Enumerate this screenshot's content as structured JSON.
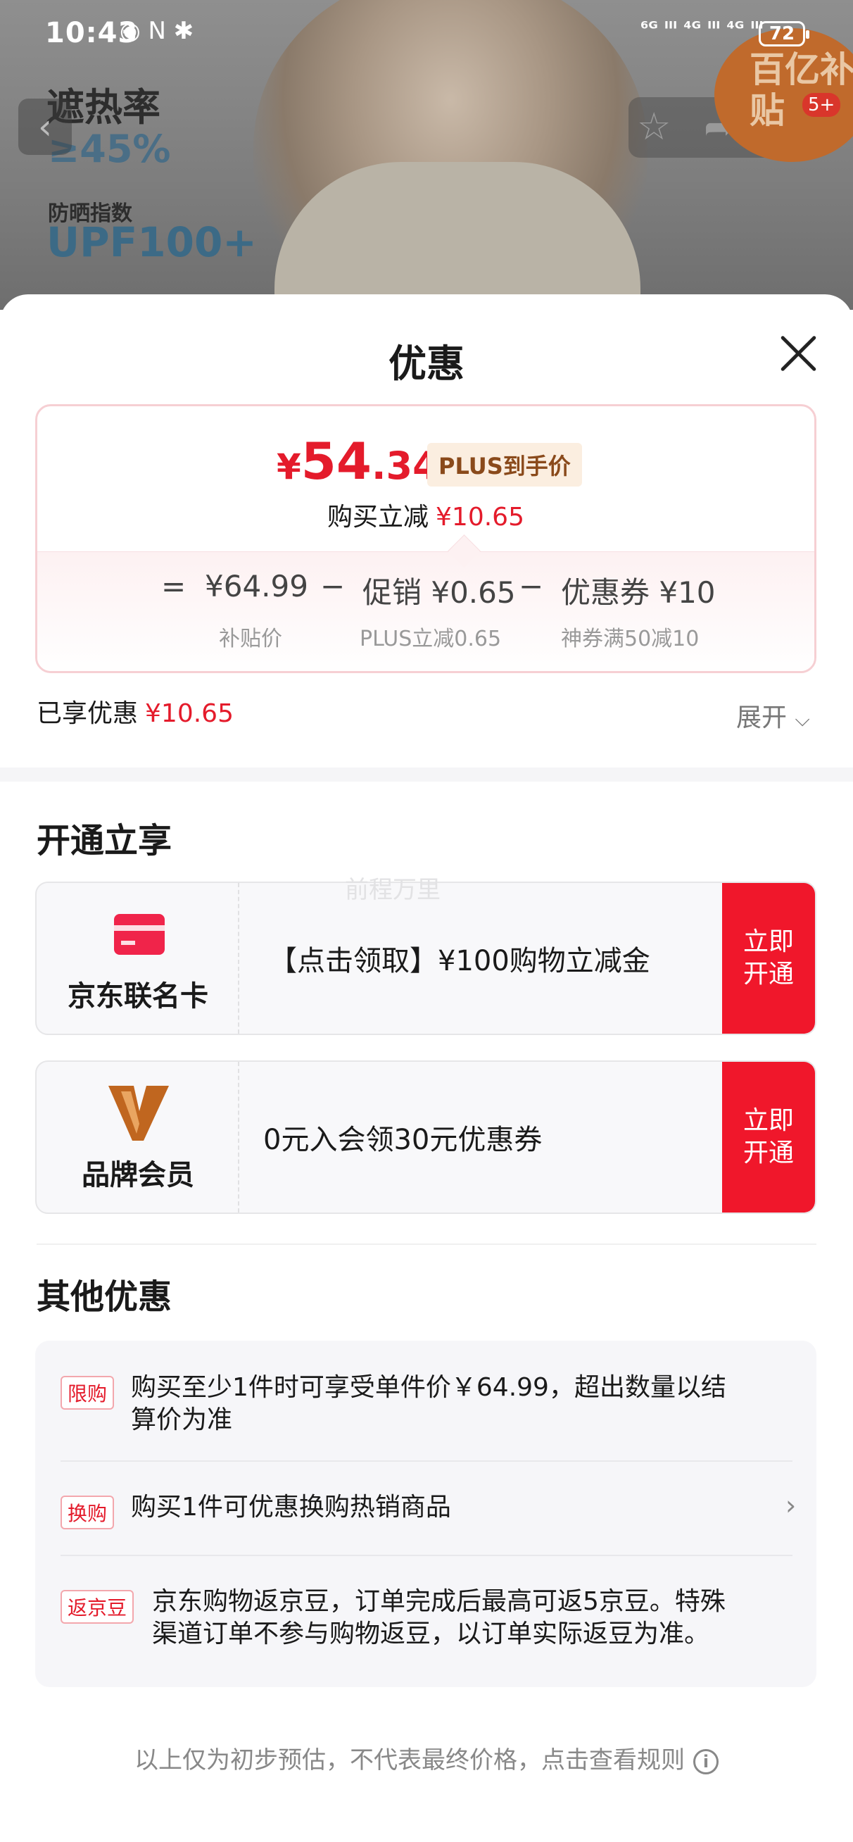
{
  "status_bar": {
    "time": "10:43",
    "left_icons": "◉ N ✱",
    "right_icons": "⁶ᴳ ᴵᴵᴵ ⁴ᴳ ᴵᴵᴵ ⁴ᴳ ᴵᴵᴵ",
    "battery": "72"
  },
  "background": {
    "line1": "遮热率",
    "line2": "≥45%",
    "line3": "防晒指数",
    "line4": "UPF100+",
    "badge_text": "百亿补贴",
    "badge_count": "5+"
  },
  "sheet": {
    "title": "优惠",
    "price": {
      "yen": "¥",
      "integer": "54",
      "decimal": ".34",
      "plus_tag": "PLUS到手价",
      "reduce_label": "购买立减",
      "reduce_value": "¥10.65"
    },
    "calc": {
      "eq": "=",
      "base_value": "¥64.99",
      "base_label": "补贴价",
      "minus1": "−",
      "promo_value": "促销 ¥0.65",
      "promo_label": "PLUS立减0.65",
      "minus2": "−",
      "coupon_value": "优惠券 ¥10",
      "coupon_label": "神券满50减10"
    },
    "enjoyed_label": "已享优惠",
    "enjoyed_value": "¥10.65",
    "expand_label": "展开",
    "open_section_title": "开通立享",
    "cards": [
      {
        "name": "京东联名卡",
        "desc": "【点击领取】¥100购物立减金",
        "btn_line1": "立即",
        "btn_line2": "开通"
      },
      {
        "name": "品牌会员",
        "desc": "0元入会领30元优惠券",
        "btn_line1": "立即",
        "btn_line2": "开通"
      }
    ],
    "watermark": "前程万里",
    "other_section_title": "其他优惠",
    "other_items": [
      {
        "tag": "限购",
        "text_line1": "购买至少1件时可享受单件价￥64.99，超出数量以结",
        "text_line2": "算价为准"
      },
      {
        "tag": "换购",
        "text_line1": "购买1件可优惠换购热销商品",
        "text_line2": ""
      },
      {
        "tag": "返京豆",
        "text_line1": "京东购物返京豆，订单完成后最高可返5京豆。特殊",
        "text_line2": "渠道订单不参与购物返豆，以订单实际返豆为准。"
      }
    ],
    "footer": "以上仅为初步预估，不代表最终价格，点击查看规则"
  },
  "colors": {
    "accent_red": "#e41b2b",
    "button_red": "#f0172b",
    "plus_tag_bg": "#fbeee0"
  }
}
